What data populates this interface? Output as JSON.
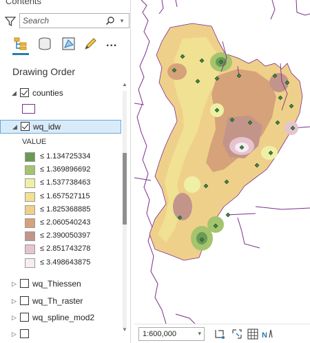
{
  "pane": {
    "title": "Contents"
  },
  "search": {
    "placeholder": "Search"
  },
  "toolbar": {
    "more": "..."
  },
  "drawing_order": "Drawing Order",
  "layers": [
    {
      "name": "counties",
      "checked": true,
      "expanded": true
    },
    {
      "name": "wq_idw",
      "checked": true,
      "expanded": true,
      "selected": true
    },
    {
      "name": "wq_Thiessen",
      "checked": false,
      "expanded": false
    },
    {
      "name": "wq_Th_raster",
      "checked": false,
      "expanded": false
    },
    {
      "name": "wq_spline_mod2",
      "checked": false,
      "expanded": false
    }
  ],
  "legend": {
    "header": "VALUE",
    "items": [
      {
        "label": "≤ 1.134725334",
        "color": "#6b9a56"
      },
      {
        "label": "≤ 1.369896692",
        "color": "#a4c46e"
      },
      {
        "label": "≤ 1.537738463",
        "color": "#eff0a6"
      },
      {
        "label": "≤ 1.657527115",
        "color": "#f1e193"
      },
      {
        "label": "≤ 1.825368885",
        "color": "#efd08a"
      },
      {
        "label": "≤ 2.060540243",
        "color": "#d6a27a"
      },
      {
        "label": "≤ 2.390050397",
        "color": "#c3958a"
      },
      {
        "label": "≤ 2.851743278",
        "color": "#e6c4cf"
      },
      {
        "label": "≤ 3.498643875",
        "color": "#f7ecf4"
      }
    ]
  },
  "status": {
    "scale": "1:600,000"
  },
  "colors": {
    "county_outline": "#7b2d8b",
    "selection": "#d9ebf9",
    "point": "#2e7d32"
  }
}
